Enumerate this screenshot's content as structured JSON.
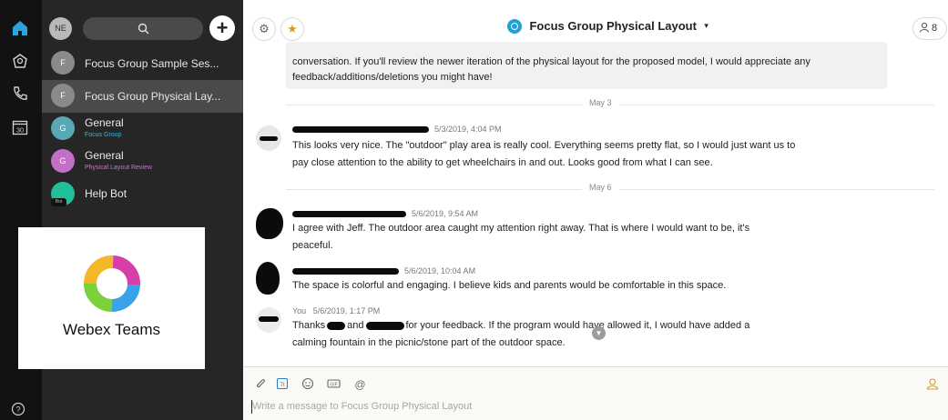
{
  "rail": {
    "icons": [
      "home-icon",
      "people-icon",
      "phone-icon",
      "calendar-icon",
      "help-icon"
    ],
    "calendar_day": "30",
    "help_symbol": "?"
  },
  "spaces_panel": {
    "user_initials": "NE",
    "search_icon": "search-icon",
    "add_label": "+",
    "items": [
      {
        "initial": "F",
        "name": "Focus Group Sample Ses...",
        "sub": "",
        "avatar_color": "#8a8a8a",
        "selected": false
      },
      {
        "initial": "F",
        "name": "Focus Group Physical Lay...",
        "sub": "",
        "avatar_color": "#8a8a8a",
        "selected": true
      },
      {
        "initial": "G",
        "name": "General",
        "sub": "Focus Group",
        "sub_color": "#43b2d6",
        "avatar_color": "#58a9b3",
        "selected": false
      },
      {
        "initial": "G",
        "name": "General",
        "sub": "Physical Layout Review",
        "sub_color": "#c879c9",
        "avatar_color": "#c46fc6",
        "selected": false
      },
      {
        "initial": "Bot",
        "name": "Help Bot",
        "sub": "",
        "avatar_color": "#1fbf9a",
        "selected": false
      }
    ]
  },
  "logo_card": {
    "text": "Webex Teams"
  },
  "header": {
    "space_title": "Focus Group Physical Layout",
    "caret": "▾",
    "participant_count": "8",
    "settings_icon": "gear-icon",
    "favorite_icon": "star-icon"
  },
  "messages": {
    "first_bubble": "conversation. If you'll review the newer iteration of the physical layout for the proposed model, I would appreciate any feedback/additions/deletions you might have!",
    "date_sep_1": "May 3",
    "date_sep_2": "May 6",
    "items": [
      {
        "time": "5/3/2019, 4:04 PM",
        "text": "This looks very nice. The \"outdoor\" play area is really cool. Everything seems pretty flat, so I would just want us to pay close attention to the ability to get wheelchairs in and out. Looks good from what I can see."
      },
      {
        "time": "5/6/2019, 9:54 AM",
        "text": "I agree with Jeff.  The outdoor area caught my attention right away.  That is where I would want to be, it's peaceful."
      },
      {
        "time": "5/6/2019, 10:04 AM",
        "text": "The space is colorful and engaging.  I believe kids and parents would be comfortable in this space."
      },
      {
        "author": "You",
        "time": "5/6/2019, 1:17 PM",
        "text_part1": "Thanks",
        "text_part2": "and",
        "text_part3": "for your feedback. If the program would have allowed it, I would have added a calming fountain in the picnic/stone part of the outdoor space."
      }
    ]
  },
  "compose": {
    "placeholder": "Write a message to Focus Group Physical Layout",
    "tools": [
      "attach-icon",
      "format-icon",
      "emoji-icon",
      "gif-icon",
      "mention-icon"
    ],
    "mention_symbol": "@"
  }
}
